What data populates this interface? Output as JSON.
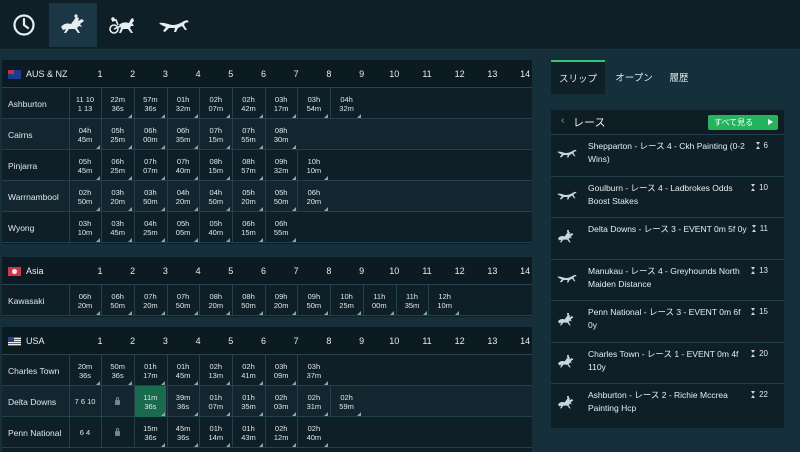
{
  "colors": {
    "accent": "#2ec96f",
    "highlight": "#1a6a4e",
    "background": "#0d1c24"
  },
  "topnav": [
    {
      "icon": "clock-icon",
      "active": false
    },
    {
      "icon": "horse-racing-icon",
      "active": true
    },
    {
      "icon": "harness-racing-icon",
      "active": false
    },
    {
      "icon": "greyhound-icon",
      "active": false
    }
  ],
  "race_numbers": [
    "1",
    "2",
    "3",
    "4",
    "5",
    "6",
    "7",
    "8",
    "9",
    "10",
    "11",
    "12",
    "13",
    "14"
  ],
  "sections": {
    "aus": {
      "title": "AUS & NZ",
      "rows": [
        {
          "venue": "Ashburton",
          "cells": [
            [
              "11 10",
              "1 13"
            ],
            [
              "22m",
              "36s"
            ],
            [
              "57m",
              "36s"
            ],
            [
              "01h",
              "32m"
            ],
            [
              "02h",
              "07m"
            ],
            [
              "02h",
              "42m"
            ],
            [
              "03h",
              "17m"
            ],
            [
              "03h",
              "54m"
            ],
            [
              "04h",
              "32m"
            ]
          ]
        },
        {
          "venue": "Cairns",
          "cells": [
            [
              "04h",
              "45m"
            ],
            [
              "05h",
              "25m"
            ],
            [
              "06h",
              "00m"
            ],
            [
              "06h",
              "35m"
            ],
            [
              "07h",
              "15m"
            ],
            [
              "07h",
              "55m"
            ],
            [
              "08h",
              "30m"
            ]
          ]
        },
        {
          "venue": "Pinjarra",
          "cells": [
            [
              "05h",
              "45m"
            ],
            [
              "06h",
              "25m"
            ],
            [
              "07h",
              "07m"
            ],
            [
              "07h",
              "40m"
            ],
            [
              "08h",
              "15m"
            ],
            [
              "08h",
              "57m"
            ],
            [
              "09h",
              "32m"
            ],
            [
              "10h",
              "10m"
            ]
          ]
        },
        {
          "venue": "Warrnambool",
          "cells": [
            [
              "02h",
              "50m"
            ],
            [
              "03h",
              "20m"
            ],
            [
              "03h",
              "50m"
            ],
            [
              "04h",
              "20m"
            ],
            [
              "04h",
              "50m"
            ],
            [
              "05h",
              "20m"
            ],
            [
              "05h",
              "50m"
            ],
            [
              "06h",
              "20m"
            ]
          ]
        },
        {
          "venue": "Wyong",
          "cells": [
            [
              "03h",
              "10m"
            ],
            [
              "03h",
              "45m"
            ],
            [
              "04h",
              "25m"
            ],
            [
              "05h",
              "05m"
            ],
            [
              "05h",
              "40m"
            ],
            [
              "06h",
              "15m"
            ],
            [
              "06h",
              "55m"
            ]
          ]
        }
      ]
    },
    "asia": {
      "title": "Asia",
      "rows": [
        {
          "venue": "Kawasaki",
          "cells": [
            [
              "06h",
              "20m"
            ],
            [
              "06h",
              "50m"
            ],
            [
              "07h",
              "20m"
            ],
            [
              "07h",
              "50m"
            ],
            [
              "08h",
              "20m"
            ],
            [
              "08h",
              "50m"
            ],
            [
              "09h",
              "20m"
            ],
            [
              "09h",
              "50m"
            ],
            [
              "10h",
              "25m"
            ],
            [
              "11h",
              "00m"
            ],
            [
              "11h",
              "35m"
            ],
            [
              "12h",
              "10m"
            ]
          ]
        }
      ]
    },
    "usa": {
      "title": "USA",
      "rows": [
        {
          "venue": "Charles Town",
          "cells": [
            [
              "20m",
              "36s"
            ],
            [
              "50m",
              "36s"
            ],
            [
              "01h",
              "17m"
            ],
            [
              "01h",
              "45m"
            ],
            [
              "02h",
              "13m"
            ],
            [
              "02h",
              "41m"
            ],
            [
              "03h",
              "09m"
            ],
            [
              "03h",
              "37m"
            ]
          ]
        },
        {
          "venue": "Delta Downs",
          "cells": [
            [
              "7 6 10",
              ""
            ],
            [
              "LOCK",
              ""
            ],
            [
              "11m",
              "36s"
            ],
            [
              "39m",
              "36s"
            ],
            [
              "01h",
              "07m"
            ],
            [
              "01h",
              "35m"
            ],
            [
              "02h",
              "03m"
            ],
            [
              "02h",
              "31m"
            ],
            [
              "02h",
              "59m"
            ]
          ]
        },
        {
          "venue": "Penn National",
          "cells": [
            [
              "6 4",
              ""
            ],
            [
              "LOCK",
              ""
            ],
            [
              "15m",
              "36s"
            ],
            [
              "45m",
              "36s"
            ],
            [
              "01h",
              "14m"
            ],
            [
              "01h",
              "43m"
            ],
            [
              "02h",
              "12m"
            ],
            [
              "02h",
              "40m"
            ]
          ]
        }
      ]
    }
  },
  "right": {
    "tabs": [
      "スリップ",
      "オープン",
      "履歴"
    ],
    "races_title": "レース",
    "see_all": "すべて見る",
    "races": [
      {
        "icon": "greyhound-icon",
        "name": "Shepparton - レース 4 - Ckh Painting (0-2 Wins)",
        "time": "6"
      },
      {
        "icon": "greyhound-icon",
        "name": "Goulburn - レース 4 - Ladbrokes Odds Boost Stakes",
        "time": "10"
      },
      {
        "icon": "horse-racing-icon",
        "name": "Delta Downs - レース 3 - EVENT 0m 5f 0y",
        "time": "11"
      },
      {
        "icon": "greyhound-icon",
        "name": "Manukau - レース 4 - Greyhounds North Maiden Distance",
        "time": "13"
      },
      {
        "icon": "horse-racing-icon",
        "name": "Penn National - レース 3 - EVENT 0m 6f 0y",
        "time": "15"
      },
      {
        "icon": "horse-racing-icon",
        "name": "Charles Town - レース 1 - EVENT 0m 4f 110y",
        "time": "20"
      },
      {
        "icon": "horse-racing-icon",
        "name": "Ashburton - レース 2 - Richie Mccrea Painting Hcp",
        "time": "22"
      }
    ]
  }
}
